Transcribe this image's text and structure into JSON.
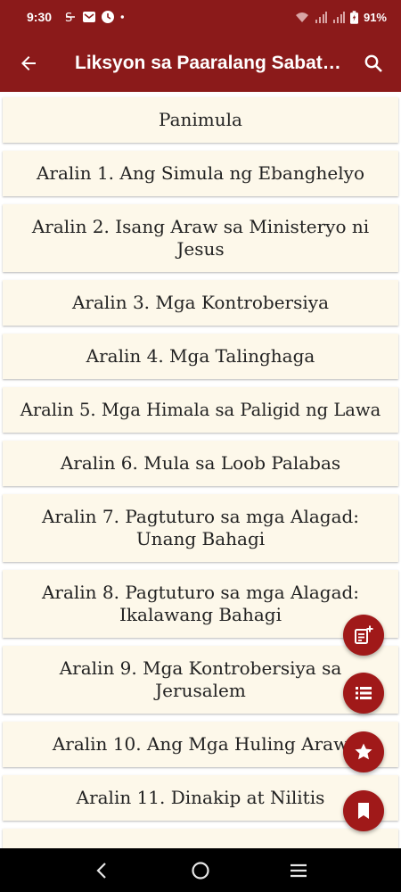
{
  "status_bar": {
    "time": "9:30",
    "battery": "91%",
    "icons": [
      "sync-icon",
      "mail-icon",
      "clock-icon",
      "dot-icon",
      "wifi-icon",
      "signal-icon",
      "signal-icon",
      "battery-icon"
    ]
  },
  "app_bar": {
    "title": "Liksyon sa Paaralang Sabat…",
    "back_icon": "arrow-back-icon",
    "search_icon": "search-icon"
  },
  "lessons": [
    "Panimula",
    "Aralin 1. Ang Simula ng Ebanghelyo",
    "Aralin 2. Isang Araw sa Ministeryo ni Jesus",
    "Aralin 3. Mga Kontrobersiya",
    "Aralin 4. Mga Talinghaga",
    "Aralin 5. Mga Himala sa Paligid ng Lawa",
    "Aralin 6. Mula sa Loob Palabas",
    "Aralin 7. Pagtuturo sa mga Alagad: Unang Bahagi",
    "Aralin 8. Pagtuturo sa mga Alagad: Ikalawang Bahagi",
    "Aralin 9. Mga Kontrobersiya sa Jerusalem",
    "Aralin 10. Ang Mga Huling Araw",
    "Aralin 11. Dinakip at Nilitis"
  ],
  "fabs": [
    "note-add-icon",
    "list-icon",
    "star-icon",
    "bookmark-icon"
  ],
  "nav_bar": [
    "back-chevron-icon",
    "home-circle-icon",
    "recents-menu-icon"
  ],
  "colors": {
    "primary": "#8b1a1a",
    "fab": "#a01919",
    "card": "#fdf8ea"
  }
}
